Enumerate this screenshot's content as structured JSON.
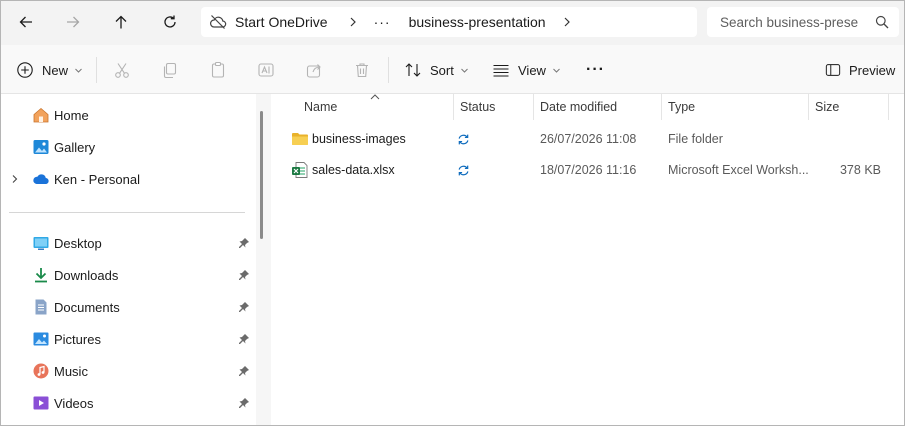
{
  "address": {
    "crumbs": [
      "Start OneDrive",
      "business-presentation"
    ],
    "more_label": "···",
    "search_placeholder": "Search business-prese"
  },
  "toolbar": {
    "new_label": "New",
    "sort_label": "Sort",
    "view_label": "View",
    "more_label": "···",
    "preview_label": "Preview"
  },
  "sidebar": {
    "top_items": [
      {
        "label": "Home",
        "icon": "home-icon"
      },
      {
        "label": "Gallery",
        "icon": "gallery-icon"
      },
      {
        "label": "Ken - Personal",
        "icon": "onedrive-cloud-icon"
      }
    ],
    "pinned_items": [
      {
        "label": "Desktop",
        "icon": "desktop-icon"
      },
      {
        "label": "Downloads",
        "icon": "downloads-icon"
      },
      {
        "label": "Documents",
        "icon": "documents-icon"
      },
      {
        "label": "Pictures",
        "icon": "pictures-icon"
      },
      {
        "label": "Music",
        "icon": "music-icon"
      },
      {
        "label": "Videos",
        "icon": "videos-icon"
      }
    ]
  },
  "columns": {
    "name": "Name",
    "status": "Status",
    "date": "Date modified",
    "type": "Type",
    "size": "Size"
  },
  "files": [
    {
      "name": "business-images",
      "icon": "folder-icon",
      "status": "sync-icon",
      "date": "26/07/2026 11:08",
      "type": "File folder",
      "size": ""
    },
    {
      "name": "sales-data.xlsx",
      "icon": "excel-file-icon",
      "status": "sync-icon",
      "date": "18/07/2026 11:16",
      "type": "Microsoft Excel Worksh...",
      "size": "378 KB"
    }
  ],
  "colors": {
    "accent": "#0067c0",
    "folder": "#f0c038",
    "excel": "#1d7a43"
  }
}
